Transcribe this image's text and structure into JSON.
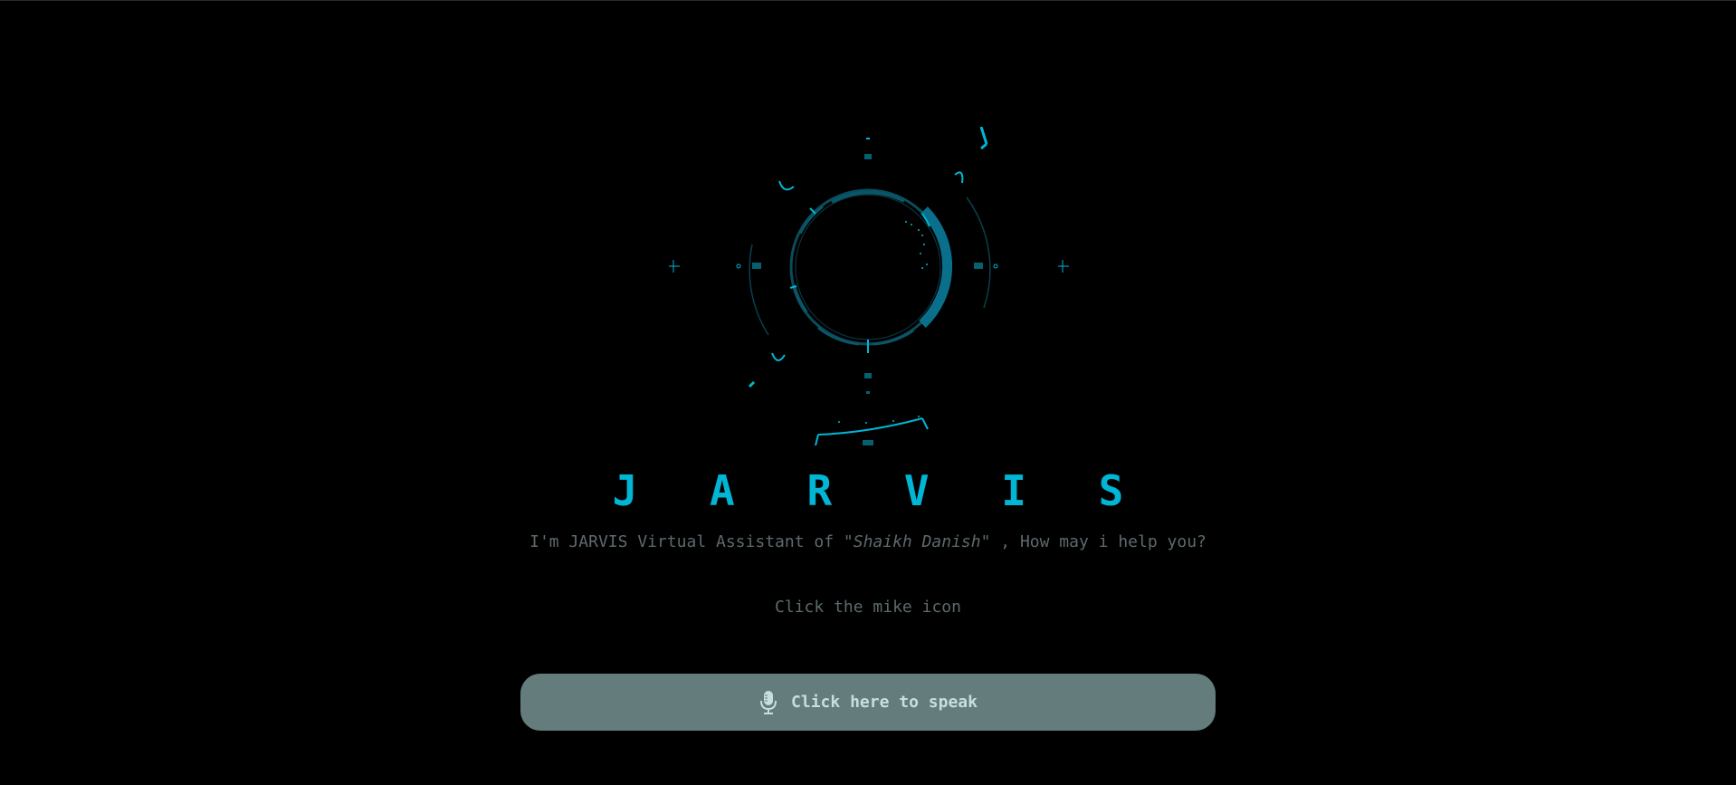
{
  "app": {
    "title": "J A R V I S",
    "subtitle_prefix": "I'm JARVIS Virtual Assistant of ",
    "subtitle_owner": "\"Shaikh Danish\"",
    "subtitle_suffix": " , How may i help you?",
    "hint": "Click the mike icon",
    "speak_button_label": "Click here to speak"
  },
  "colors": {
    "background": "#000000",
    "accent": "#00b6d4",
    "muted_text": "#5d6a6d",
    "button_bg": "#647c7c",
    "button_text": "#c6dede"
  },
  "icons": {
    "hud": "jarvis-hud-icon",
    "mic": "microphone-icon"
  }
}
